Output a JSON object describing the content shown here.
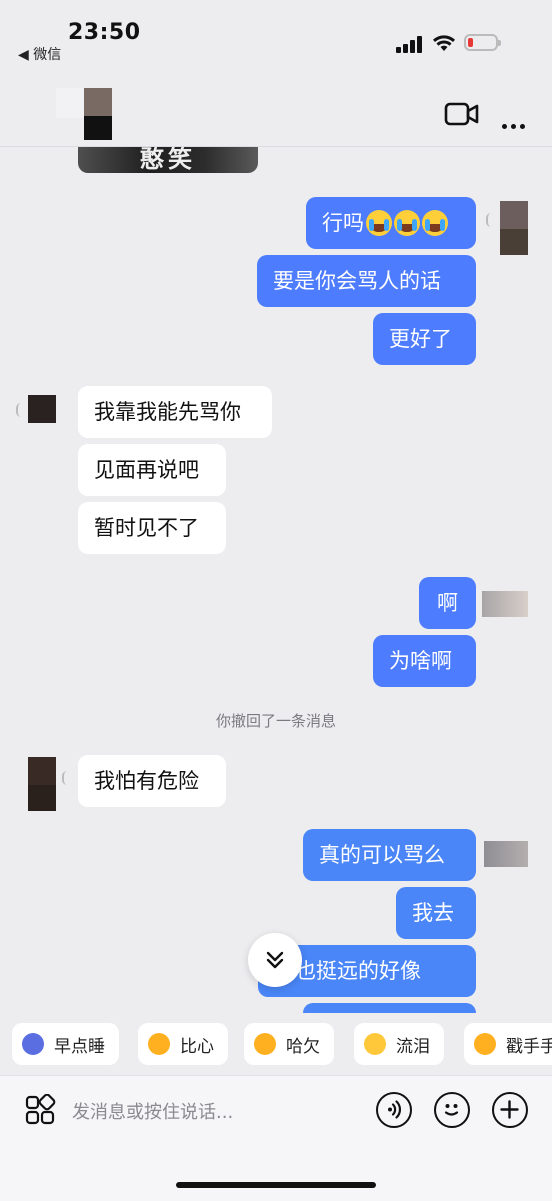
{
  "status": {
    "time": "23:50",
    "back_app": "◀ 微信"
  },
  "header": {
    "title": ""
  },
  "sticker_text": "憨笑",
  "messages": [
    {
      "side": "sent",
      "text": "行吗",
      "emoji_count": 3
    },
    {
      "side": "sent",
      "text": "要是你会骂人的话"
    },
    {
      "side": "sent",
      "text": "更好了"
    },
    {
      "side": "recv",
      "text": "我靠我能先骂你"
    },
    {
      "side": "recv",
      "text": "见面再说吧"
    },
    {
      "side": "recv",
      "text": "暂时见不了"
    },
    {
      "side": "sent",
      "text": "啊"
    },
    {
      "side": "sent",
      "text": "为啥啊"
    },
    {
      "side": "system",
      "text": "你撤回了一条消息"
    },
    {
      "side": "recv",
      "text": "我怕有危险"
    },
    {
      "side": "sent",
      "text": "真的可以骂么"
    },
    {
      "side": "sent",
      "text": "我去"
    },
    {
      "side": "sent",
      "text": "得也挺远的好像"
    }
  ],
  "quick_replies": [
    {
      "label": "早点睡",
      "icon": "moon-icon",
      "color": "#5b6ee1"
    },
    {
      "label": "比心",
      "icon": "finger-heart-icon",
      "color": "#ffb020"
    },
    {
      "label": "哈欠",
      "icon": "yawn-icon",
      "color": "#ffb020"
    },
    {
      "label": "流泪",
      "icon": "crying-icon",
      "color": "#ffc83a"
    },
    {
      "label": "戳手手",
      "icon": "poke-hands-icon",
      "color": "#ffb020"
    }
  ],
  "input": {
    "placeholder": "发消息或按住说话..."
  },
  "colors": {
    "sent_bubble": "#4d7cfe",
    "received_bubble": "#ffffff",
    "background": "#ededf0"
  }
}
